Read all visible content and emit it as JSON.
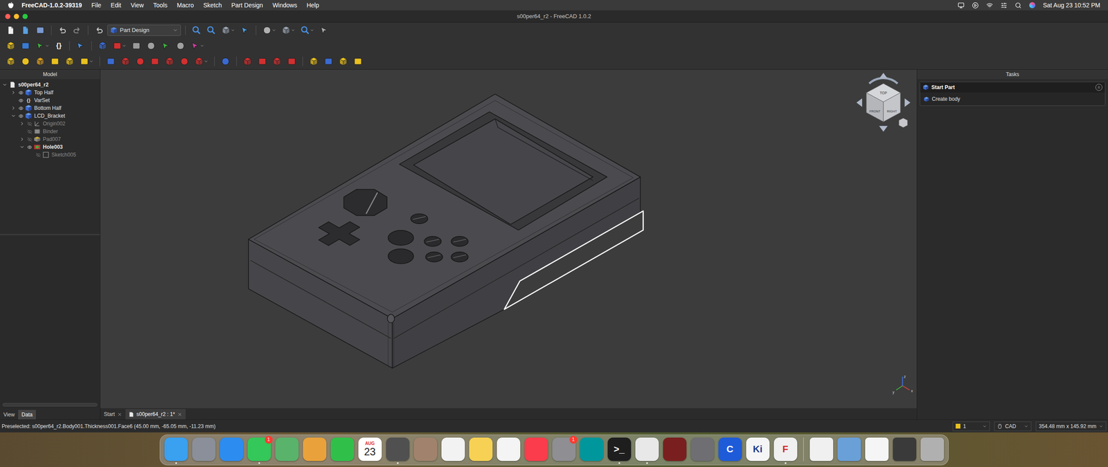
{
  "menu_bar": {
    "app_name": "FreeCAD-1.0.2-39319",
    "items": [
      "File",
      "Edit",
      "View",
      "Tools",
      "Macro",
      "Sketch",
      "Part Design",
      "Windows",
      "Help"
    ],
    "clock": "Sat Aug 23 10:52 PM"
  },
  "window": {
    "title": "s00per64_r2 - FreeCAD 1.0.2"
  },
  "toolbar": {
    "workbench": "Part Design",
    "varset_button": "{}"
  },
  "model_panel": {
    "title": "Model",
    "tree": [
      {
        "label": "s00per64_r2",
        "level": 0,
        "kind": "document",
        "icon_text": "",
        "expandable": true,
        "expanded": true,
        "visible": true,
        "dimmed": false,
        "bold": true
      },
      {
        "label": "Top Half",
        "level": 1,
        "kind": "body",
        "icon_text": "",
        "expandable": true,
        "expanded": false,
        "visible": true,
        "dimmed": false,
        "bold": false
      },
      {
        "label": "VarSet",
        "level": 1,
        "kind": "varset",
        "icon_text": "{}",
        "expandable": false,
        "expanded": false,
        "visible": true,
        "dimmed": false,
        "bold": false
      },
      {
        "label": "Bottom Half",
        "level": 1,
        "kind": "body",
        "icon_text": "",
        "expandable": true,
        "expanded": false,
        "visible": true,
        "dimmed": false,
        "bold": false
      },
      {
        "label": "LCD_Bracket",
        "level": 1,
        "kind": "body",
        "icon_text": "",
        "expandable": true,
        "expanded": true,
        "visible": true,
        "dimmed": false,
        "bold": false
      },
      {
        "label": "Origin002",
        "level": 2,
        "kind": "origin",
        "icon_text": "",
        "expandable": true,
        "expanded": false,
        "visible": false,
        "dimmed": true,
        "bold": false
      },
      {
        "label": "Binder",
        "level": 2,
        "kind": "binder",
        "icon_text": "",
        "expandable": false,
        "expanded": false,
        "visible": false,
        "dimmed": true,
        "bold": false
      },
      {
        "label": "Pad007",
        "level": 2,
        "kind": "pad",
        "icon_text": "",
        "expandable": true,
        "expanded": false,
        "visible": false,
        "dimmed": true,
        "bold": false
      },
      {
        "label": "Hole003",
        "level": 2,
        "kind": "hole",
        "icon_text": "",
        "expandable": true,
        "expanded": true,
        "visible": true,
        "dimmed": false,
        "bold": true
      },
      {
        "label": "Sketch005",
        "level": 3,
        "kind": "sketch",
        "icon_text": "",
        "expandable": false,
        "expanded": false,
        "visible": false,
        "dimmed": true,
        "bold": false
      }
    ]
  },
  "property_tabs": [
    {
      "label": "View",
      "selected": false
    },
    {
      "label": "Data",
      "selected": true
    }
  ],
  "viewport": {
    "preselected_face": true,
    "nav_cube": {
      "faces": [
        "TOP",
        "FRONT",
        "RIGHT"
      ]
    },
    "axes": [
      "x",
      "y",
      "z"
    ]
  },
  "document_tabs": [
    {
      "label": "Start",
      "selected": false
    },
    {
      "label": "s00per64_r2 : 1*",
      "selected": true
    }
  ],
  "tasks_panel": {
    "title": "Tasks",
    "sections": [
      {
        "title": "Start Part",
        "expanded": true,
        "actions": [
          "Create body"
        ]
      }
    ]
  },
  "status_bar": {
    "message": "Preselected: s00per64_r2.Body001.Thickness001.Face6 (45.00 mm, -65.05 mm, -11.23 mm)",
    "draw_style": "1",
    "draw_style_color": "#e8c020",
    "navigation": "CAD",
    "dimensions": "354.48 mm x 145.92 mm"
  },
  "dock": {
    "apps": [
      {
        "kind": "app",
        "label": "",
        "badge": "",
        "color": "#3aa0f0",
        "text_color": "#ffffff",
        "running": true
      },
      {
        "kind": "app",
        "label": "",
        "badge": "",
        "color": "#8a8f99",
        "text_color": "#ffffff",
        "running": false
      },
      {
        "kind": "app",
        "label": "",
        "badge": "",
        "color": "#2d8cf0",
        "text_color": "#ffffff",
        "running": false
      },
      {
        "kind": "app",
        "label": "",
        "badge": "1",
        "color": "#34c759",
        "text_color": "#ffffff",
        "running": true
      },
      {
        "kind": "app",
        "label": "",
        "badge": "",
        "color": "#59b36b",
        "text_color": "#ffffff",
        "running": false
      },
      {
        "kind": "app",
        "label": "",
        "badge": "",
        "color": "#e9a23b",
        "text_color": "#ffffff",
        "running": false
      },
      {
        "kind": "app",
        "label": "",
        "badge": "",
        "color": "#30c04a",
        "text_color": "#ffffff",
        "running": false
      },
      {
        "kind": "calendar",
        "label": "AUG",
        "day": "23",
        "badge": "",
        "color": "#ffffff",
        "text_color": "#e03030",
        "running": false
      },
      {
        "kind": "app",
        "label": "",
        "badge": "",
        "color": "#505050",
        "text_color": "#ffffff",
        "running": true
      },
      {
        "kind": "app",
        "label": "",
        "badge": "",
        "color": "#a0826d",
        "text_color": "#ffffff",
        "running": false
      },
      {
        "kind": "app",
        "label": "",
        "badge": "",
        "color": "#f2f2f2",
        "text_color": "#333333",
        "running": false
      },
      {
        "kind": "app",
        "label": "",
        "badge": "",
        "color": "#f7d154",
        "text_color": "#333333",
        "running": false
      },
      {
        "kind": "app",
        "label": "",
        "badge": "",
        "color": "#f4f4f4",
        "text_color": "#2d6fe0",
        "running": false
      },
      {
        "kind": "app",
        "label": "",
        "badge": "",
        "color": "#fa3c4c",
        "text_color": "#ffffff",
        "running": false
      },
      {
        "kind": "app",
        "label": "",
        "badge": "1",
        "color": "#8e8e93",
        "text_color": "#ffffff",
        "running": false
      },
      {
        "kind": "app",
        "label": "",
        "badge": "",
        "color": "#00979c",
        "text_color": "#ffffff",
        "running": false
      },
      {
        "kind": "app",
        "label": ">_",
        "badge": "",
        "color": "#1e1e1e",
        "text_color": "#ffffff",
        "running": true
      },
      {
        "kind": "app",
        "label": "",
        "badge": "",
        "color": "#e8e8e8",
        "text_color": "#333333",
        "running": true
      },
      {
        "kind": "app",
        "label": "",
        "badge": "",
        "color": "#7a1f1f",
        "text_color": "#ffffff",
        "running": false
      },
      {
        "kind": "app",
        "label": "",
        "badge": "",
        "color": "#6e6e73",
        "text_color": "#ffffff",
        "running": false
      },
      {
        "kind": "app",
        "label": "C",
        "badge": "",
        "color": "#1e5bd8",
        "text_color": "#ffffff",
        "running": false
      },
      {
        "kind": "app",
        "label": "Ki",
        "badge": "",
        "color": "#f5f5f5",
        "text_color": "#1a3a8a",
        "running": false
      },
      {
        "kind": "app",
        "label": "F",
        "badge": "",
        "color": "#f0f0f0",
        "text_color": "#d02828",
        "running": true
      }
    ],
    "documents": [
      {
        "label": "",
        "color": "#f0f0f0"
      },
      {
        "label": "",
        "color": "#6aa0d8"
      },
      {
        "label": "",
        "color": "#f5f5f5"
      },
      {
        "label": "",
        "color": "#3a3a3a"
      },
      {
        "label": "",
        "color": "#b0b0b0"
      }
    ]
  }
}
